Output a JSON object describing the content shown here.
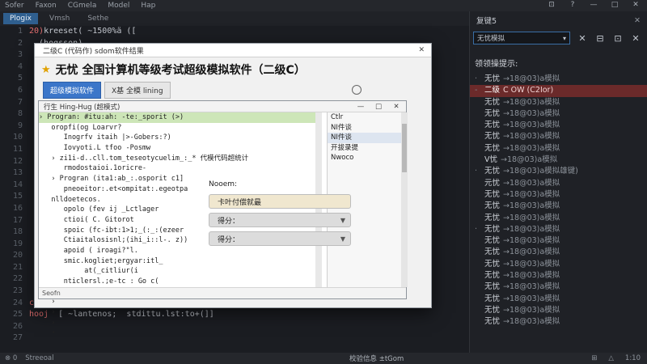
{
  "menubar": {
    "items": [
      "Sofer",
      "Faxon",
      "CGmela",
      "Model",
      "Hap"
    ],
    "window_controls": [
      "⊡",
      "?",
      "—",
      "□",
      "✕"
    ]
  },
  "editor": {
    "tabs": [
      "Plogix",
      "Vmsh",
      "Sethe"
    ],
    "active_tab": 0,
    "gutter_lines": [
      "1",
      "2",
      "3",
      "4",
      "5",
      "6",
      "7",
      "8",
      "9",
      "10",
      "11",
      "12",
      "13",
      "14",
      "15",
      "16",
      "17",
      "18",
      "19",
      "20",
      "21",
      "22",
      "23",
      "24",
      "25",
      "26",
      "27"
    ],
    "code_lines": [
      {
        "kw": "20)",
        "text": "kreeset( ~1500%ä (["
      },
      {
        "kw": "",
        "text": "  (hogsson)"
      },
      {
        "kw": "",
        "text": ""
      },
      {
        "kw": "",
        "text": ""
      },
      {
        "kw": "",
        "text": ""
      },
      {
        "kw": "",
        "text": ""
      },
      {
        "kw": "",
        "text": ""
      },
      {
        "kw": "",
        "text": ""
      },
      {
        "kw": "",
        "text": ""
      },
      {
        "kw": "",
        "text": ""
      },
      {
        "kw": "",
        "text": ""
      },
      {
        "kw": "",
        "text": ""
      },
      {
        "kw": "",
        "text": ""
      },
      {
        "kw": "",
        "text": ""
      },
      {
        "kw": "",
        "text": ""
      },
      {
        "kw": "",
        "text": ""
      },
      {
        "kw": "",
        "text": ""
      },
      {
        "kw": "",
        "text": ""
      },
      {
        "kw": "",
        "text": ""
      },
      {
        "kw": "",
        "text": ""
      },
      {
        "kw": "",
        "text": ""
      },
      {
        "kw": "",
        "text": ""
      },
      {
        "kw": "",
        "text": ""
      },
      {
        "kw": "cooi",
        "text": "  Steonos: ~s-60l:aoleotorist,  <0066°-ek)"
      },
      {
        "kw": "hooj",
        "text": "  [ ~lantenos;  stdittu.lst:to+(]]"
      },
      {
        "kw": "",
        "text": ""
      },
      {
        "kw": "",
        "text": ""
      }
    ]
  },
  "right_panel": {
    "title": "复键5",
    "close_glyph": "✕",
    "select_value": "无忧模拟",
    "tool_buttons": [
      "✕",
      "⊟",
      "⊡",
      "✕"
    ],
    "section_label": "领领操提示:",
    "items": [
      {
        "mark": "·",
        "name": "无忧",
        "detail": "→18@03)a模拟"
      },
      {
        "mark": "-",
        "name": "二级",
        "detail": "C  OW  (C2Ior)"
      },
      {
        "mark": "",
        "name": "无忧",
        "detail": "→18@03)a模拟"
      },
      {
        "mark": "",
        "name": "无忧",
        "detail": "→18@03)a模拟"
      },
      {
        "mark": "",
        "name": "无忧",
        "detail": "→18@03)a模拟"
      },
      {
        "mark": "",
        "name": "无忧",
        "detail": "→18@03)a模拟"
      },
      {
        "mark": "",
        "name": "无忧",
        "detail": "→18@03)a模拟"
      },
      {
        "mark": "",
        "name": "V忧",
        "detail": "→18@03)a模拟"
      },
      {
        "mark": "·",
        "name": "无忧",
        "detail": "→18@03)a模拟雄键)"
      },
      {
        "mark": "",
        "name": "元忧",
        "detail": "→18@03)a模拟"
      },
      {
        "mark": "",
        "name": "无忧",
        "detail": "→18@03)a模拟"
      },
      {
        "mark": "",
        "name": "无忧",
        "detail": "→18@03)a模拟"
      },
      {
        "mark": "",
        "name": "无忧",
        "detail": "→18@03)a模拟"
      },
      {
        "mark": "·",
        "name": "无忧",
        "detail": "→18@03)a模拟"
      },
      {
        "mark": "",
        "name": "无忧",
        "detail": "→18@03)a模拟"
      },
      {
        "mark": "",
        "name": "无忧",
        "detail": "→18@03)a模拟"
      },
      {
        "mark": "",
        "name": "无忧",
        "detail": "→18@03)a模拟"
      },
      {
        "mark": "",
        "name": "无忧",
        "detail": "→18@03)a模拟"
      },
      {
        "mark": "",
        "name": "无忧",
        "detail": "→18@03)a模拟"
      },
      {
        "mark": "",
        "name": "无忧",
        "detail": "→18@03)a模拟"
      },
      {
        "mark": "",
        "name": "无忧",
        "detail": "→18@03)a模拟"
      },
      {
        "mark": "",
        "name": "无忧",
        "detail": "→18@03)a模拟"
      }
    ],
    "highlighted_index": 1
  },
  "statusbar": {
    "left_items": [
      "⊗ 0",
      "Streeoal"
    ],
    "message": "校验信息 ±tGom",
    "right_items": [
      "⊞",
      "△",
      "1:10"
    ]
  },
  "dialog": {
    "title": "二级C (代码作) sdom软件结果",
    "close_glyph": "✕",
    "heading": "无忧 全国计算机等级考试超级模拟软件（二级C）",
    "star_glyph": "★",
    "tabs": [
      "超级模拟软件",
      "Ⅹ基 全模 lining"
    ],
    "active_tab": 0,
    "inner": {
      "title": "行生 Hing-Hug (超模式)",
      "controls": [
        "—",
        "□",
        "✕"
      ],
      "tree_lines": [
        "› Progran: #itu:ah: -te:_sporit (>)",
        "   oropfi(og Loarvr?",
        "      Inogrfv itaih |>-Gobers:?)",
        "      Iovyoti.L tfoo -Posmw",
        "   › zi1i-d..cll.tom_teseotycuelim_:_* 代模代码超统计",
        "      rmodostaioi.1oricre-",
        "   › Progran (ita1:ab_:.osporit c1]",
        "      pneoeitor:.et<ompitat:.egeotpa",
        "   nlldoetecos.",
        "      opolo (fev ij _Lctlager",
        "      ctioi( C. Gitorot",
        "      spoic (fc-ibt:1>1;_(:_:(ezeer",
        "      Ctiaitalosisnl;(ihi_i::l-. z))",
        "      apoid ( iroagi?\"l.",
        "      smic.kogliet;ergyar:itl_",
        "           at(_citliur(i",
        "      nticlersl.;e-tc : Go c(",
        "      ciccacioi  f.r .(",
        "   ›",
        "   ›",
        "   ›",
        "   ›"
      ],
      "selected_tree_index": 0,
      "side_items": [
        "Ctlr",
        "NI件谈",
        "NI件谈",
        "开拔录提",
        "Nwoco"
      ],
      "selected_side_index": 2,
      "notes_label": "Nooem:",
      "fields": [
        {
          "label": "卡叶付偿就最",
          "dropdown": false
        },
        {
          "label": "得分：",
          "dropdown": true
        },
        {
          "label": "得分：",
          "dropdown": true
        }
      ],
      "status": "Seofn"
    }
  }
}
